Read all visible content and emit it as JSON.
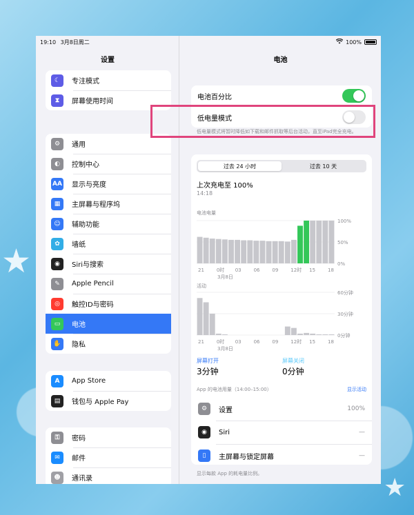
{
  "status": {
    "time": "19:10",
    "date": "3月8日周二",
    "battery": "100%"
  },
  "sidebar": {
    "title": "设置",
    "group0": [
      {
        "label": "专注模式",
        "icon": "moon-icon",
        "color": "#5e5ce6"
      },
      {
        "label": "屏幕使用时间",
        "icon": "hourglass-icon",
        "color": "#5e5ce6"
      }
    ],
    "group1": [
      {
        "label": "通用",
        "icon": "gear-icon",
        "color": "#8e8e93"
      },
      {
        "label": "控制中心",
        "icon": "control-center-icon",
        "color": "#8e8e93"
      },
      {
        "label": "显示与亮度",
        "icon": "display-aa-icon",
        "color": "#3478f6"
      },
      {
        "label": "主屏幕与程序坞",
        "icon": "home-grid-icon",
        "color": "#3478f6"
      },
      {
        "label": "辅助功能",
        "icon": "accessibility-icon",
        "color": "#3478f6"
      },
      {
        "label": "墙纸",
        "icon": "wallpaper-flower-icon",
        "color": "#32ade6"
      },
      {
        "label": "Siri与搜索",
        "icon": "siri-icon",
        "color": "#222"
      },
      {
        "label": "Apple Pencil",
        "icon": "pencil-icon",
        "color": "#8e8e93"
      },
      {
        "label": "触控ID与密码",
        "icon": "fingerprint-icon",
        "color": "#ff3b30"
      },
      {
        "label": "电池",
        "icon": "battery-icon",
        "color": "#34c759",
        "selected": true
      },
      {
        "label": "隐私",
        "icon": "hand-icon",
        "color": "#3478f6"
      }
    ],
    "group2": [
      {
        "label": "App Store",
        "icon": "appstore-icon",
        "color": "#1a8cff"
      },
      {
        "label": "钱包与 Apple Pay",
        "icon": "wallet-icon",
        "color": "#222"
      }
    ],
    "group3": [
      {
        "label": "密码",
        "icon": "key-icon",
        "color": "#8e8e93"
      },
      {
        "label": "邮件",
        "icon": "mail-icon",
        "color": "#1a8cff"
      },
      {
        "label": "通讯录",
        "icon": "contacts-icon",
        "color": "#a0a0a5"
      }
    ]
  },
  "main": {
    "title": "电池",
    "battery_percentage_label": "电池百分比",
    "battery_percentage_on": true,
    "low_power_label": "低电量模式",
    "low_power_on": false,
    "low_power_note": "低电量模式将暂时降低如下载和邮件抓取等后台活动，直至iPad完全充电。",
    "tabs": [
      "过去 24 小时",
      "过去 10 天"
    ],
    "last_charge_label": "上次充电至 100%",
    "last_charge_time": "14:18",
    "battery_level_label": "电池电量",
    "activity_label": "活动",
    "level_ticks": [
      "100%",
      "50%",
      "0%"
    ],
    "activity_ticks": [
      "60分钟",
      "30分钟",
      "0分钟"
    ],
    "x_ticks": [
      "21",
      "0时",
      "03",
      "06",
      "09",
      "12时",
      "15",
      "18"
    ],
    "x_date": "3月8日",
    "screen_on_label": "屏幕打开",
    "screen_on_value": "3分钟",
    "screen_off_label": "屏幕关闭",
    "screen_off_value": "0分钟",
    "app_usage_label": "App 的电池用量（14:00–15:00）",
    "show_activity": "显示活动",
    "apps": [
      {
        "name": "设置",
        "value": "100%",
        "icon": "settings-icon",
        "color": "#8e8e93"
      },
      {
        "name": "Siri",
        "value": "—",
        "icon": "siri-icon",
        "color": "#222"
      },
      {
        "name": "主屏幕与锁定屏幕",
        "value": "—",
        "icon": "home-lock-icon",
        "color": "#3478f6"
      }
    ],
    "footer_note": "显示每款 App 的耗电量比例。"
  },
  "chart_data": [
    {
      "type": "bar",
      "title": "电池电量",
      "categories": [
        "21",
        "22",
        "23",
        "0时",
        "01",
        "02",
        "03",
        "04",
        "05",
        "06",
        "07",
        "08",
        "09",
        "10",
        "11",
        "12时",
        "13",
        "14",
        "15",
        "16",
        "17",
        "18"
      ],
      "values": [
        62,
        60,
        58,
        57,
        56,
        55,
        55,
        54,
        54,
        53,
        53,
        52,
        52,
        52,
        51,
        55,
        88,
        100,
        100,
        100,
        100,
        100
      ],
      "charging": [
        false,
        false,
        false,
        false,
        false,
        false,
        false,
        false,
        false,
        false,
        false,
        false,
        false,
        false,
        false,
        false,
        true,
        true,
        false,
        false,
        false,
        false
      ],
      "ylim": [
        0,
        100
      ]
    },
    {
      "type": "bar",
      "title": "活动",
      "categories": [
        "21",
        "22",
        "23",
        "0时",
        "01",
        "02",
        "03",
        "04",
        "05",
        "06",
        "07",
        "08",
        "09",
        "10",
        "11",
        "12时",
        "13",
        "14",
        "15",
        "16",
        "17",
        "18"
      ],
      "values": [
        52,
        46,
        30,
        2,
        1,
        0,
        0,
        0,
        0,
        0,
        0,
        0,
        0,
        0,
        12,
        10,
        2,
        3,
        2,
        1,
        1,
        1
      ],
      "ylim": [
        0,
        60
      ]
    }
  ]
}
